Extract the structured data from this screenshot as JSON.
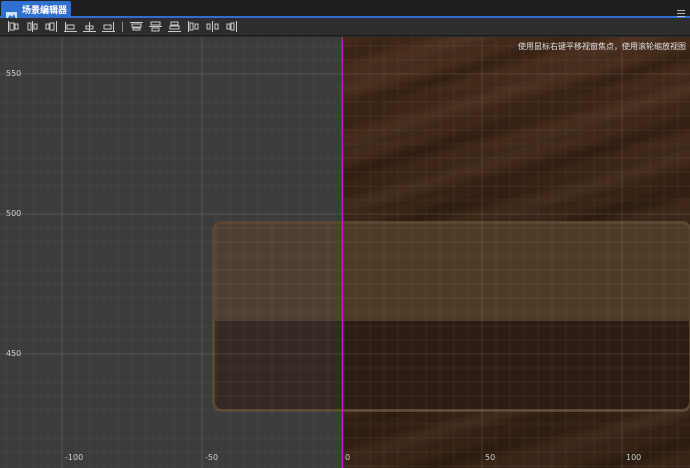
{
  "tab": {
    "title": "场景编辑器",
    "icon": "scene-editor-icon"
  },
  "menu": {
    "icon": "menu-icon"
  },
  "toolbar": {
    "tools": [
      {
        "name": "align-left-icon"
      },
      {
        "name": "align-hcenter-icon"
      },
      {
        "name": "align-right-icon"
      },
      {
        "name": "align-bottom-left-icon"
      },
      {
        "name": "align-bottom-center-icon"
      },
      {
        "name": "align-bottom-right-icon"
      },
      {
        "name": "align-top-icon"
      },
      {
        "name": "align-vmiddle-icon"
      },
      {
        "name": "align-bottom-icon"
      },
      {
        "name": "distribute-left-icon"
      },
      {
        "name": "distribute-hcenter-icon"
      },
      {
        "name": "distribute-right-icon"
      }
    ]
  },
  "viewport": {
    "hint": "使用鼠标右键平移视窗焦点，使用滚轮缩放视图",
    "y_labels": [
      "550",
      "500",
      "450"
    ],
    "x_labels": [
      "-100",
      "-50",
      "0",
      "50",
      "100"
    ],
    "colors": {
      "origin_line": "#c020c0",
      "grid_bg": "#3c3c3c",
      "wood": "#3d2616"
    }
  }
}
